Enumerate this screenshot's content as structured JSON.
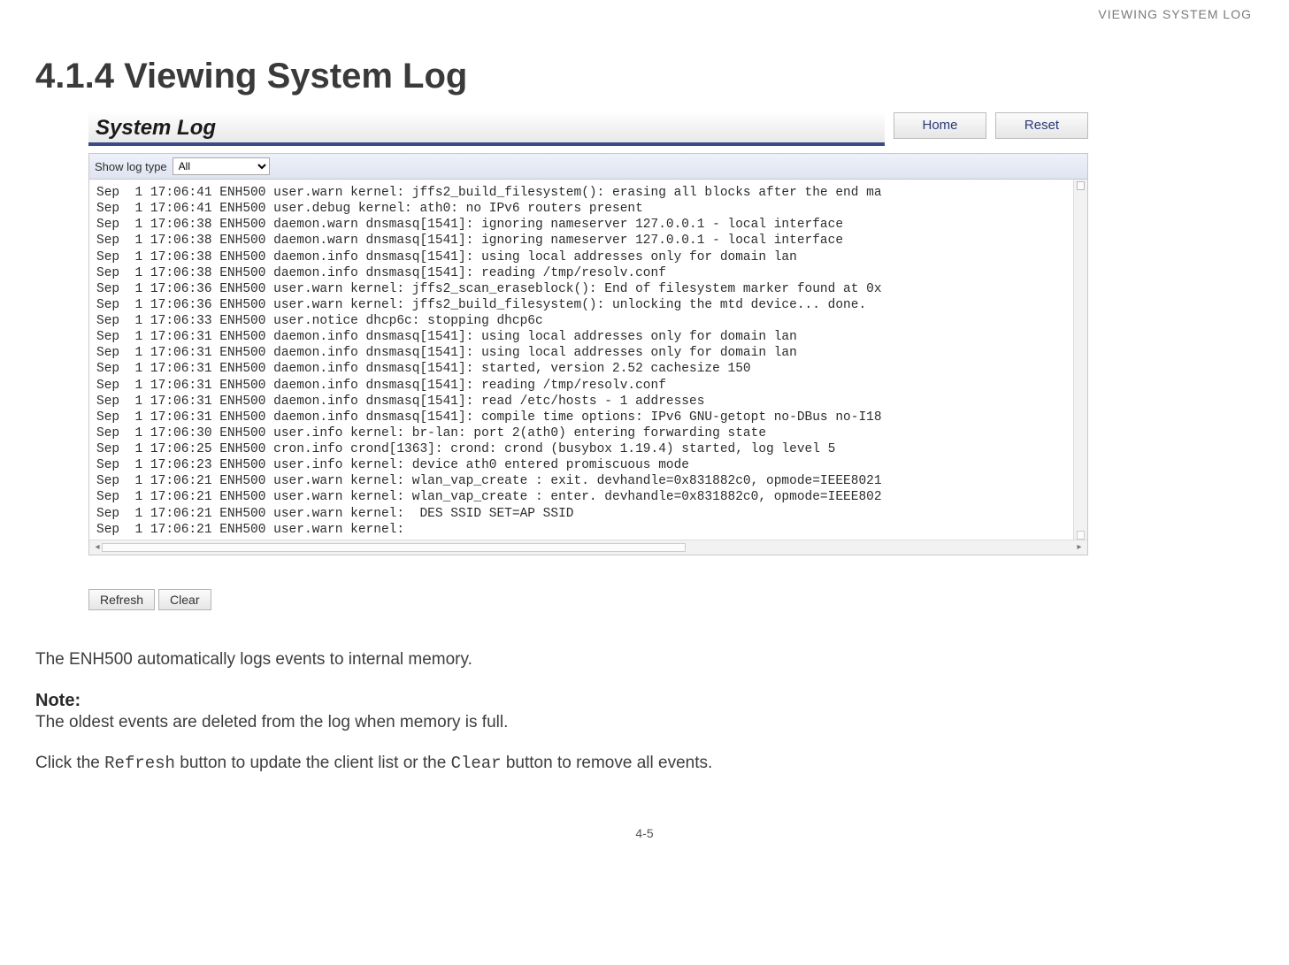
{
  "header_right": "VIEWING SYSTEM LOG",
  "section_title": "4.1.4 Viewing System Log",
  "panel": {
    "title": "System Log",
    "home_btn": "Home",
    "reset_btn": "Reset",
    "filter_label": "Show log type",
    "filter_selected": "All",
    "filter_options": [
      "All"
    ],
    "refresh_btn": "Refresh",
    "clear_btn": "Clear",
    "log_lines": [
      "Sep  1 17:06:41 ENH500 user.warn kernel: jffs2_build_filesystem(): erasing all blocks after the end ma",
      "Sep  1 17:06:41 ENH500 user.debug kernel: ath0: no IPv6 routers present",
      "Sep  1 17:06:38 ENH500 daemon.warn dnsmasq[1541]: ignoring nameserver 127.0.0.1 - local interface",
      "Sep  1 17:06:38 ENH500 daemon.warn dnsmasq[1541]: ignoring nameserver 127.0.0.1 - local interface",
      "Sep  1 17:06:38 ENH500 daemon.info dnsmasq[1541]: using local addresses only for domain lan",
      "Sep  1 17:06:38 ENH500 daemon.info dnsmasq[1541]: reading /tmp/resolv.conf",
      "Sep  1 17:06:36 ENH500 user.warn kernel: jffs2_scan_eraseblock(): End of filesystem marker found at 0x",
      "Sep  1 17:06:36 ENH500 user.warn kernel: jffs2_build_filesystem(): unlocking the mtd device... done.",
      "Sep  1 17:06:33 ENH500 user.notice dhcp6c: stopping dhcp6c",
      "Sep  1 17:06:31 ENH500 daemon.info dnsmasq[1541]: using local addresses only for domain lan",
      "Sep  1 17:06:31 ENH500 daemon.info dnsmasq[1541]: using local addresses only for domain lan",
      "Sep  1 17:06:31 ENH500 daemon.info dnsmasq[1541]: started, version 2.52 cachesize 150",
      "Sep  1 17:06:31 ENH500 daemon.info dnsmasq[1541]: reading /tmp/resolv.conf",
      "Sep  1 17:06:31 ENH500 daemon.info dnsmasq[1541]: read /etc/hosts - 1 addresses",
      "Sep  1 17:06:31 ENH500 daemon.info dnsmasq[1541]: compile time options: IPv6 GNU-getopt no-DBus no-I18",
      "Sep  1 17:06:30 ENH500 user.info kernel: br-lan: port 2(ath0) entering forwarding state",
      "Sep  1 17:06:25 ENH500 cron.info crond[1363]: crond: crond (busybox 1.19.4) started, log level 5",
      "Sep  1 17:06:23 ENH500 user.info kernel: device ath0 entered promiscuous mode",
      "Sep  1 17:06:21 ENH500 user.warn kernel: wlan_vap_create : exit. devhandle=0x831882c0, opmode=IEEE8021",
      "Sep  1 17:06:21 ENH500 user.warn kernel: wlan_vap_create : enter. devhandle=0x831882c0, opmode=IEEE802",
      "Sep  1 17:06:21 ENH500 user.warn kernel:  DES SSID SET=AP SSID",
      "Sep  1 17:06:21 ENH500 user.warn kernel:"
    ]
  },
  "body_text": "The ENH500 automatically logs events to internal memory.",
  "note_label": "Note:",
  "note_text": "The oldest events are deleted from the log when memory is full.",
  "instr_prefix": "Click the ",
  "instr_refresh": "Refresh",
  "instr_mid": " button to update the client list or the ",
  "instr_clear": "Clear",
  "instr_suffix": " button to remove all events.",
  "page_num": "4-5"
}
